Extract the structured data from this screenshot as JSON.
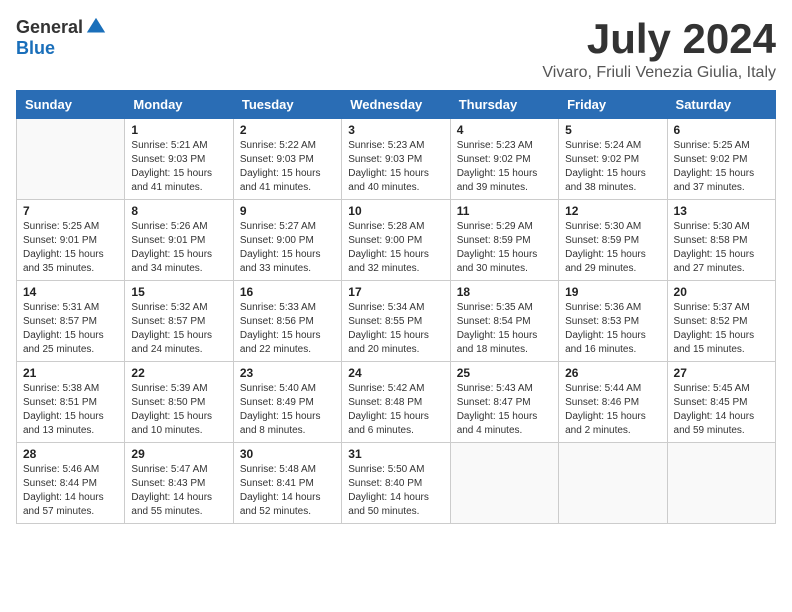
{
  "header": {
    "logo_general": "General",
    "logo_blue": "Blue",
    "month_year": "July 2024",
    "location": "Vivaro, Friuli Venezia Giulia, Italy"
  },
  "days_of_week": [
    "Sunday",
    "Monday",
    "Tuesday",
    "Wednesday",
    "Thursday",
    "Friday",
    "Saturday"
  ],
  "weeks": [
    [
      {
        "day": "",
        "text": ""
      },
      {
        "day": "1",
        "text": "Sunrise: 5:21 AM\nSunset: 9:03 PM\nDaylight: 15 hours\nand 41 minutes."
      },
      {
        "day": "2",
        "text": "Sunrise: 5:22 AM\nSunset: 9:03 PM\nDaylight: 15 hours\nand 41 minutes."
      },
      {
        "day": "3",
        "text": "Sunrise: 5:23 AM\nSunset: 9:03 PM\nDaylight: 15 hours\nand 40 minutes."
      },
      {
        "day": "4",
        "text": "Sunrise: 5:23 AM\nSunset: 9:02 PM\nDaylight: 15 hours\nand 39 minutes."
      },
      {
        "day": "5",
        "text": "Sunrise: 5:24 AM\nSunset: 9:02 PM\nDaylight: 15 hours\nand 38 minutes."
      },
      {
        "day": "6",
        "text": "Sunrise: 5:25 AM\nSunset: 9:02 PM\nDaylight: 15 hours\nand 37 minutes."
      }
    ],
    [
      {
        "day": "7",
        "text": "Sunrise: 5:25 AM\nSunset: 9:01 PM\nDaylight: 15 hours\nand 35 minutes."
      },
      {
        "day": "8",
        "text": "Sunrise: 5:26 AM\nSunset: 9:01 PM\nDaylight: 15 hours\nand 34 minutes."
      },
      {
        "day": "9",
        "text": "Sunrise: 5:27 AM\nSunset: 9:00 PM\nDaylight: 15 hours\nand 33 minutes."
      },
      {
        "day": "10",
        "text": "Sunrise: 5:28 AM\nSunset: 9:00 PM\nDaylight: 15 hours\nand 32 minutes."
      },
      {
        "day": "11",
        "text": "Sunrise: 5:29 AM\nSunset: 8:59 PM\nDaylight: 15 hours\nand 30 minutes."
      },
      {
        "day": "12",
        "text": "Sunrise: 5:30 AM\nSunset: 8:59 PM\nDaylight: 15 hours\nand 29 minutes."
      },
      {
        "day": "13",
        "text": "Sunrise: 5:30 AM\nSunset: 8:58 PM\nDaylight: 15 hours\nand 27 minutes."
      }
    ],
    [
      {
        "day": "14",
        "text": "Sunrise: 5:31 AM\nSunset: 8:57 PM\nDaylight: 15 hours\nand 25 minutes."
      },
      {
        "day": "15",
        "text": "Sunrise: 5:32 AM\nSunset: 8:57 PM\nDaylight: 15 hours\nand 24 minutes."
      },
      {
        "day": "16",
        "text": "Sunrise: 5:33 AM\nSunset: 8:56 PM\nDaylight: 15 hours\nand 22 minutes."
      },
      {
        "day": "17",
        "text": "Sunrise: 5:34 AM\nSunset: 8:55 PM\nDaylight: 15 hours\nand 20 minutes."
      },
      {
        "day": "18",
        "text": "Sunrise: 5:35 AM\nSunset: 8:54 PM\nDaylight: 15 hours\nand 18 minutes."
      },
      {
        "day": "19",
        "text": "Sunrise: 5:36 AM\nSunset: 8:53 PM\nDaylight: 15 hours\nand 16 minutes."
      },
      {
        "day": "20",
        "text": "Sunrise: 5:37 AM\nSunset: 8:52 PM\nDaylight: 15 hours\nand 15 minutes."
      }
    ],
    [
      {
        "day": "21",
        "text": "Sunrise: 5:38 AM\nSunset: 8:51 PM\nDaylight: 15 hours\nand 13 minutes."
      },
      {
        "day": "22",
        "text": "Sunrise: 5:39 AM\nSunset: 8:50 PM\nDaylight: 15 hours\nand 10 minutes."
      },
      {
        "day": "23",
        "text": "Sunrise: 5:40 AM\nSunset: 8:49 PM\nDaylight: 15 hours\nand 8 minutes."
      },
      {
        "day": "24",
        "text": "Sunrise: 5:42 AM\nSunset: 8:48 PM\nDaylight: 15 hours\nand 6 minutes."
      },
      {
        "day": "25",
        "text": "Sunrise: 5:43 AM\nSunset: 8:47 PM\nDaylight: 15 hours\nand 4 minutes."
      },
      {
        "day": "26",
        "text": "Sunrise: 5:44 AM\nSunset: 8:46 PM\nDaylight: 15 hours\nand 2 minutes."
      },
      {
        "day": "27",
        "text": "Sunrise: 5:45 AM\nSunset: 8:45 PM\nDaylight: 14 hours\nand 59 minutes."
      }
    ],
    [
      {
        "day": "28",
        "text": "Sunrise: 5:46 AM\nSunset: 8:44 PM\nDaylight: 14 hours\nand 57 minutes."
      },
      {
        "day": "29",
        "text": "Sunrise: 5:47 AM\nSunset: 8:43 PM\nDaylight: 14 hours\nand 55 minutes."
      },
      {
        "day": "30",
        "text": "Sunrise: 5:48 AM\nSunset: 8:41 PM\nDaylight: 14 hours\nand 52 minutes."
      },
      {
        "day": "31",
        "text": "Sunrise: 5:50 AM\nSunset: 8:40 PM\nDaylight: 14 hours\nand 50 minutes."
      },
      {
        "day": "",
        "text": ""
      },
      {
        "day": "",
        "text": ""
      },
      {
        "day": "",
        "text": ""
      }
    ]
  ]
}
